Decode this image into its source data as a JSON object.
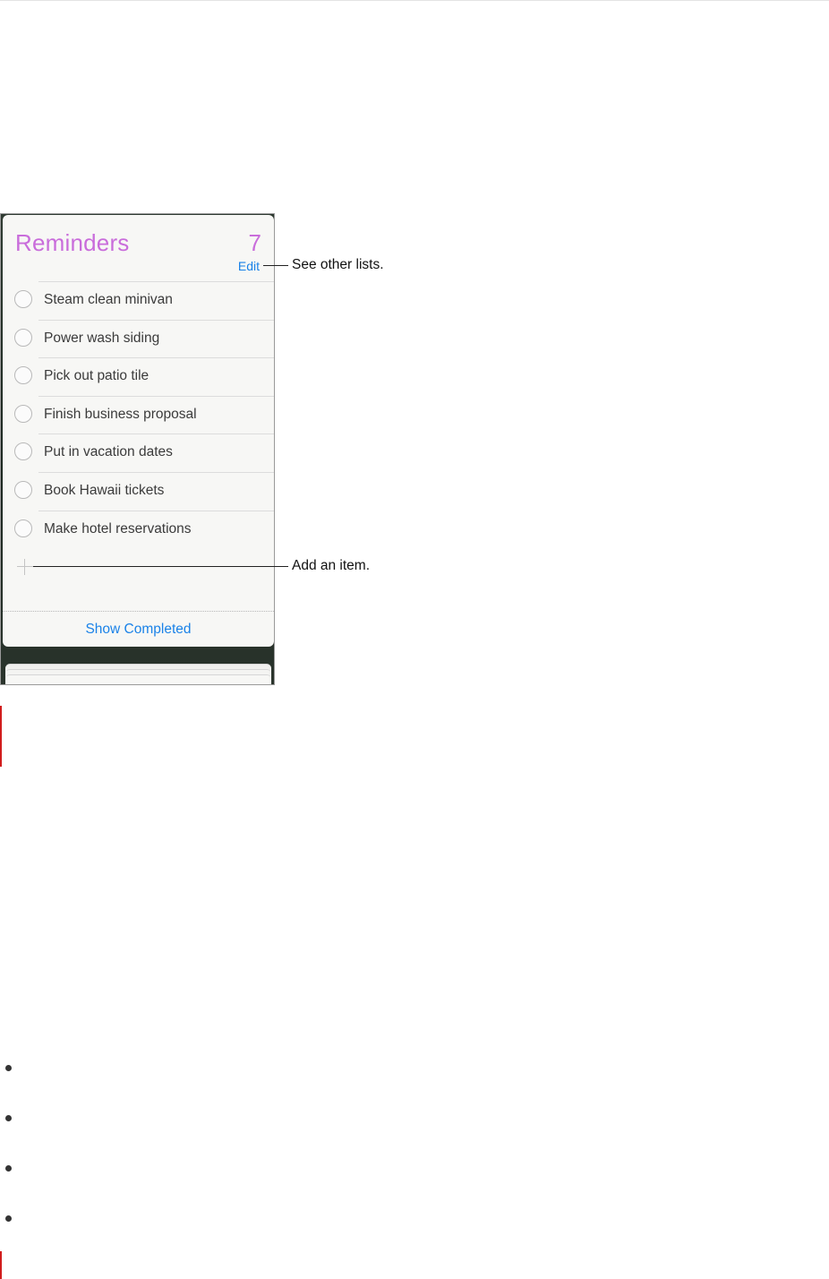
{
  "reminders": {
    "title": "Reminders",
    "count": "7",
    "edit_label": "Edit",
    "items": [
      {
        "label": "Steam clean minivan"
      },
      {
        "label": "Power wash siding"
      },
      {
        "label": "Pick out patio tile"
      },
      {
        "label": "Finish business proposal"
      },
      {
        "label": "Put in vacation dates"
      },
      {
        "label": "Book Hawaii tickets"
      },
      {
        "label": "Make hotel reservations"
      }
    ],
    "show_completed_label": "Show Completed"
  },
  "callouts": {
    "edit": "See other lists.",
    "add": "Add an item."
  },
  "colors": {
    "title": "#c96ddb",
    "link": "#1a82e8",
    "rule": "#d11d1d"
  }
}
